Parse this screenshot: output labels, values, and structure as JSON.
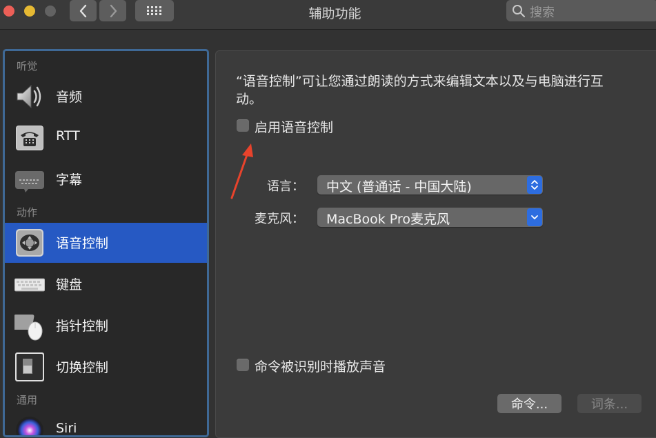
{
  "window": {
    "title": "辅助功能",
    "search_placeholder": "搜索"
  },
  "sidebar": {
    "sections": {
      "hearing": "听觉",
      "motor": "动作",
      "general": "通用"
    },
    "items": [
      {
        "label": "音频",
        "icon": "speaker-icon"
      },
      {
        "label": "RTT",
        "icon": "telephone-icon"
      },
      {
        "label": "字幕",
        "icon": "captions-icon"
      },
      {
        "label": "语音控制",
        "icon": "voice-control-icon",
        "selected": true
      },
      {
        "label": "键盘",
        "icon": "keyboard-icon"
      },
      {
        "label": "指针控制",
        "icon": "pointer-icon"
      },
      {
        "label": "切换控制",
        "icon": "switch-control-icon"
      },
      {
        "label": "Siri",
        "icon": "siri-icon"
      }
    ]
  },
  "main": {
    "description": "“语音控制”可让您通过朗读的方式来编辑文本以及与电脑进行互动。",
    "enable_checkbox": {
      "label": "启用语音控制",
      "checked": false
    },
    "language": {
      "label": "语言：",
      "value": "中文 (普通话 - 中国大陆)"
    },
    "microphone": {
      "label": "麦克风：",
      "value": "MacBook Pro麦克风"
    },
    "sound_checkbox": {
      "label": "命令被识别时播放声音",
      "checked": false
    },
    "buttons": {
      "commands": "命令...",
      "vocabulary": "词条..."
    }
  },
  "colors": {
    "selection": "#2659c3",
    "popup_arrow": "#2d6de0",
    "annotation_arrow": "#e8432c"
  }
}
